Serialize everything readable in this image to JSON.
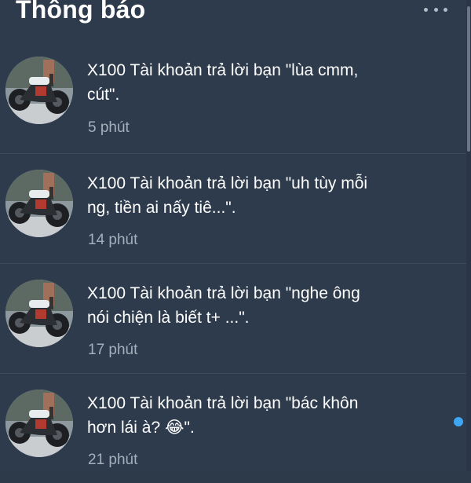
{
  "header": {
    "title": "Thông báo",
    "more_icon": "ellipsis-icon"
  },
  "notifications": [
    {
      "text_line1": "X100 Tài khoản trả lời bạn \"lùa cmm,",
      "text_line2": "cút\".",
      "time": "5 phút",
      "unread": false,
      "avatar": "motorcycle-avatar"
    },
    {
      "text_line1": "X100 Tài khoản trả lời bạn \"uh tùy mỗi",
      "text_line2": "ng, tiền ai nấy tiê...\".",
      "time": "14 phút",
      "unread": false,
      "avatar": "motorcycle-avatar"
    },
    {
      "text_line1": "X100 Tài khoản trả lời bạn \"nghe ông",
      "text_line2": "nói chiện là biết t+ ...\".",
      "time": "17 phút",
      "unread": false,
      "avatar": "motorcycle-avatar"
    },
    {
      "text_line1": "X100 Tài khoản trả lời bạn \"bác khôn",
      "text_line2": "hơn lái à? 😂\".",
      "time": "21 phút",
      "unread": true,
      "avatar": "motorcycle-avatar"
    }
  ],
  "colors": {
    "background": "#2e3b4c",
    "text": "#ffffff",
    "muted": "#a5b0bc",
    "unread_dot": "#3ea6f2"
  }
}
